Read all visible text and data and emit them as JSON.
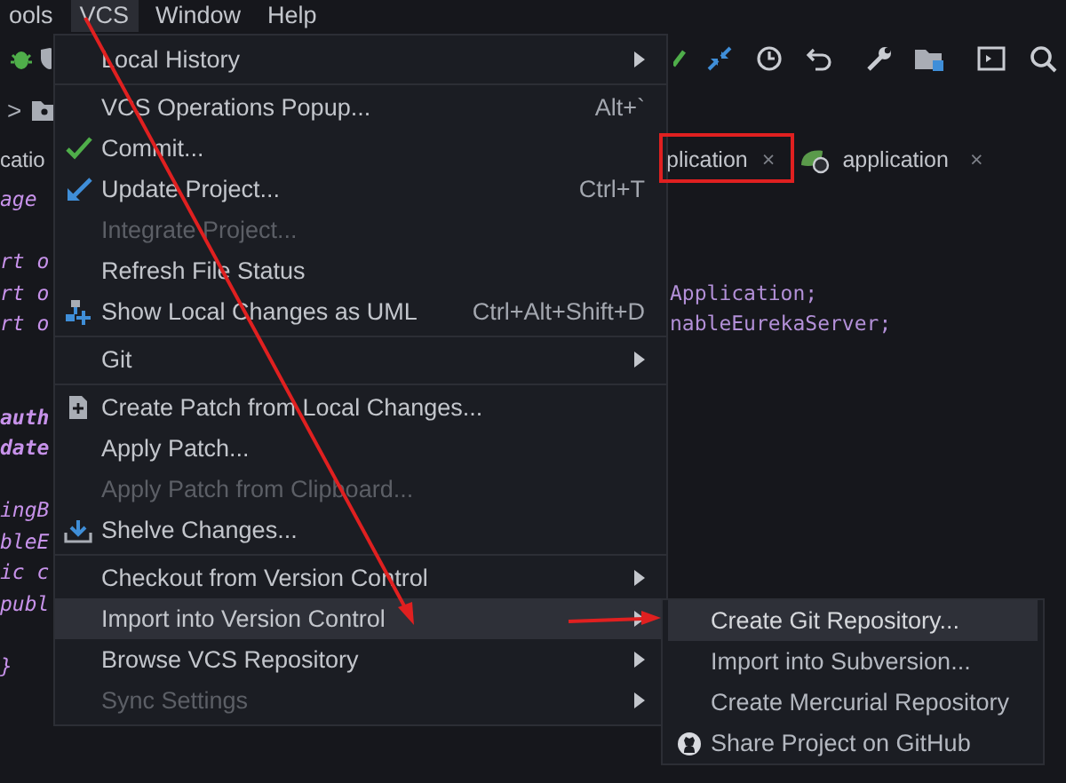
{
  "menubar": [
    {
      "label": "ools",
      "selected": false
    },
    {
      "label": "VCS",
      "selected": true
    },
    {
      "label": "Window",
      "selected": false
    },
    {
      "label": "Help",
      "selected": false
    }
  ],
  "navbar": {
    "separator": ">"
  },
  "tabs": [
    {
      "label": "catio"
    },
    {
      "label": "plication",
      "close": "×"
    },
    {
      "label": "application",
      "close": "×"
    }
  ],
  "code": [
    {
      "kind": "line",
      "left": "age"
    },
    {
      "kind": "blank"
    },
    {
      "kind": "line",
      "left": "rt o"
    },
    {
      "kind": "line",
      "left": "rt o",
      "right": "Application;"
    },
    {
      "kind": "line",
      "left": "rt o",
      "right": "nableEurekaServer;"
    },
    {
      "kind": "blank"
    },
    {
      "kind": "blank"
    },
    {
      "kind": "line",
      "left": "auth"
    },
    {
      "kind": "line",
      "left": "date"
    },
    {
      "kind": "blank"
    },
    {
      "kind": "line",
      "left": "ingB"
    },
    {
      "kind": "line",
      "left": "bleE"
    },
    {
      "kind": "line",
      "left": "ic c"
    },
    {
      "kind": "line",
      "left": "publ"
    },
    {
      "kind": "blank"
    },
    {
      "kind": "line",
      "left": "}"
    }
  ],
  "vcs_menu": {
    "items": [
      {
        "kind": "item",
        "label": "Local History",
        "submenu": true,
        "disabled": false,
        "selected": false
      },
      {
        "kind": "separator"
      },
      {
        "kind": "item",
        "label": "VCS Operations Popup...",
        "shortcut": "Alt+`",
        "submenu": false,
        "disabled": false,
        "selected": false
      },
      {
        "kind": "item",
        "label": "Commit...",
        "submenu": false,
        "disabled": false,
        "selected": false
      },
      {
        "kind": "item",
        "label": "Update Project...",
        "shortcut": "Ctrl+T",
        "submenu": false,
        "disabled": false,
        "selected": false
      },
      {
        "kind": "item",
        "label": "Integrate Project...",
        "submenu": false,
        "disabled": true,
        "selected": false
      },
      {
        "kind": "item",
        "label": "Refresh File Status",
        "submenu": false,
        "disabled": false,
        "selected": false
      },
      {
        "kind": "item",
        "label": "Show Local Changes as UML",
        "shortcut": "Ctrl+Alt+Shift+D",
        "submenu": false,
        "disabled": false,
        "selected": false
      },
      {
        "kind": "separator"
      },
      {
        "kind": "item",
        "label": "Git",
        "submenu": true,
        "disabled": false,
        "selected": false
      },
      {
        "kind": "separator"
      },
      {
        "kind": "item",
        "label": "Create Patch from Local Changes...",
        "submenu": false,
        "disabled": false,
        "selected": false
      },
      {
        "kind": "item",
        "label": "Apply Patch...",
        "submenu": false,
        "disabled": false,
        "selected": false
      },
      {
        "kind": "item",
        "label": "Apply Patch from Clipboard...",
        "submenu": false,
        "disabled": true,
        "selected": false
      },
      {
        "kind": "item",
        "label": "Shelve Changes...",
        "submenu": false,
        "disabled": false,
        "selected": false
      },
      {
        "kind": "separator"
      },
      {
        "kind": "item",
        "label": "Checkout from Version Control",
        "submenu": true,
        "disabled": false,
        "selected": false
      },
      {
        "kind": "item",
        "label": "Import into Version Control",
        "submenu": true,
        "disabled": false,
        "selected": true
      },
      {
        "kind": "item",
        "label": "Browse VCS Repository",
        "submenu": true,
        "disabled": false,
        "selected": false
      },
      {
        "kind": "item",
        "label": "Sync Settings",
        "submenu": true,
        "disabled": true,
        "selected": false
      }
    ]
  },
  "import_submenu": {
    "items": [
      {
        "kind": "item",
        "label": "Create Git Repository...",
        "disabled": false,
        "selected": true
      },
      {
        "kind": "item",
        "label": "Import into Subversion...",
        "disabled": false,
        "selected": false
      },
      {
        "kind": "item",
        "label": "Create Mercurial Repository",
        "disabled": false,
        "selected": false
      },
      {
        "kind": "item",
        "label": "Share Project on GitHub",
        "disabled": false,
        "selected": false
      }
    ]
  }
}
